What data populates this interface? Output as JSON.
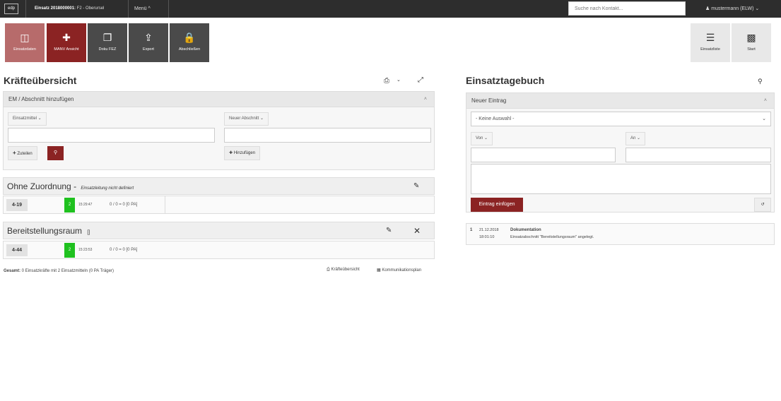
{
  "topbar": {
    "logo": "edp",
    "title_bold": "Einsatz 2018000001:",
    "title_rest": " F2 - Oberursel",
    "menu": "Menü ^",
    "search_placeholder": "Suche nach Kontakt...",
    "user": "mustermann (ELW)"
  },
  "toolbar": {
    "tiles": [
      {
        "label": "Einsatzdaten",
        "icon": "folder-icon"
      },
      {
        "label": "MANV Ansicht",
        "icon": "medkit-icon"
      },
      {
        "label": "Doku FEZ",
        "icon": "copy-icon"
      },
      {
        "label": "Export",
        "icon": "upload-icon"
      },
      {
        "label": "Abschließen",
        "icon": "lock-icon"
      }
    ],
    "right_tiles": [
      {
        "label": "Einsatzliste",
        "icon": "list-icon"
      },
      {
        "label": "Start",
        "icon": "grid-icon"
      }
    ]
  },
  "left": {
    "title": "Kräfteübersicht",
    "panel_title": "EM / Abschnitt hinzufügen",
    "einsatzmittel_dd": "Einsatzmittel",
    "abschnitt_dd": "Neuer Abschnitt",
    "zuteilen": "Zuteilen",
    "hinzufuegen": "Hinzufügen",
    "groups": [
      {
        "title": "Ohne Zuordnung",
        "dash": " - ",
        "subtitle": "Einsatzleitung nicht definiert",
        "row": {
          "code": "4-19",
          "count": "2",
          "time": "15:29:47",
          "stats": "0 / 0 = 0   [0 PA]"
        }
      },
      {
        "title": "Bereitstellungsraum",
        "subtitle": "[]",
        "row": {
          "code": "4-44",
          "count": "2",
          "time": "15:23:53",
          "stats": "0 / 0 = 0   [0 PA]"
        }
      }
    ],
    "footer_bold": "Gesamt:",
    "footer_text": " 0 Einsatzkräfte mit 2 Einsatzmitteln (0 PA Träger)",
    "link1": "Kräfteübersicht",
    "link2": "Kommunikationsplan"
  },
  "right": {
    "title": "Einsatztagebuch",
    "panel_title": "Neuer Eintrag",
    "select_value": "- Keine Auswahl -",
    "von": "Von",
    "an": "An",
    "submit": "Eintrag einfügen",
    "entries": [
      {
        "num": "1",
        "date": "21.12.2018",
        "time": "18:01:10",
        "title": "Dokumentation",
        "text": "Einsatzabschnitt \"Bereitstellungsraum\" angelegt."
      }
    ]
  },
  "colors": {
    "accent": "#8b2323",
    "green": "#1fc11f",
    "dark": "#2d2d2d"
  }
}
